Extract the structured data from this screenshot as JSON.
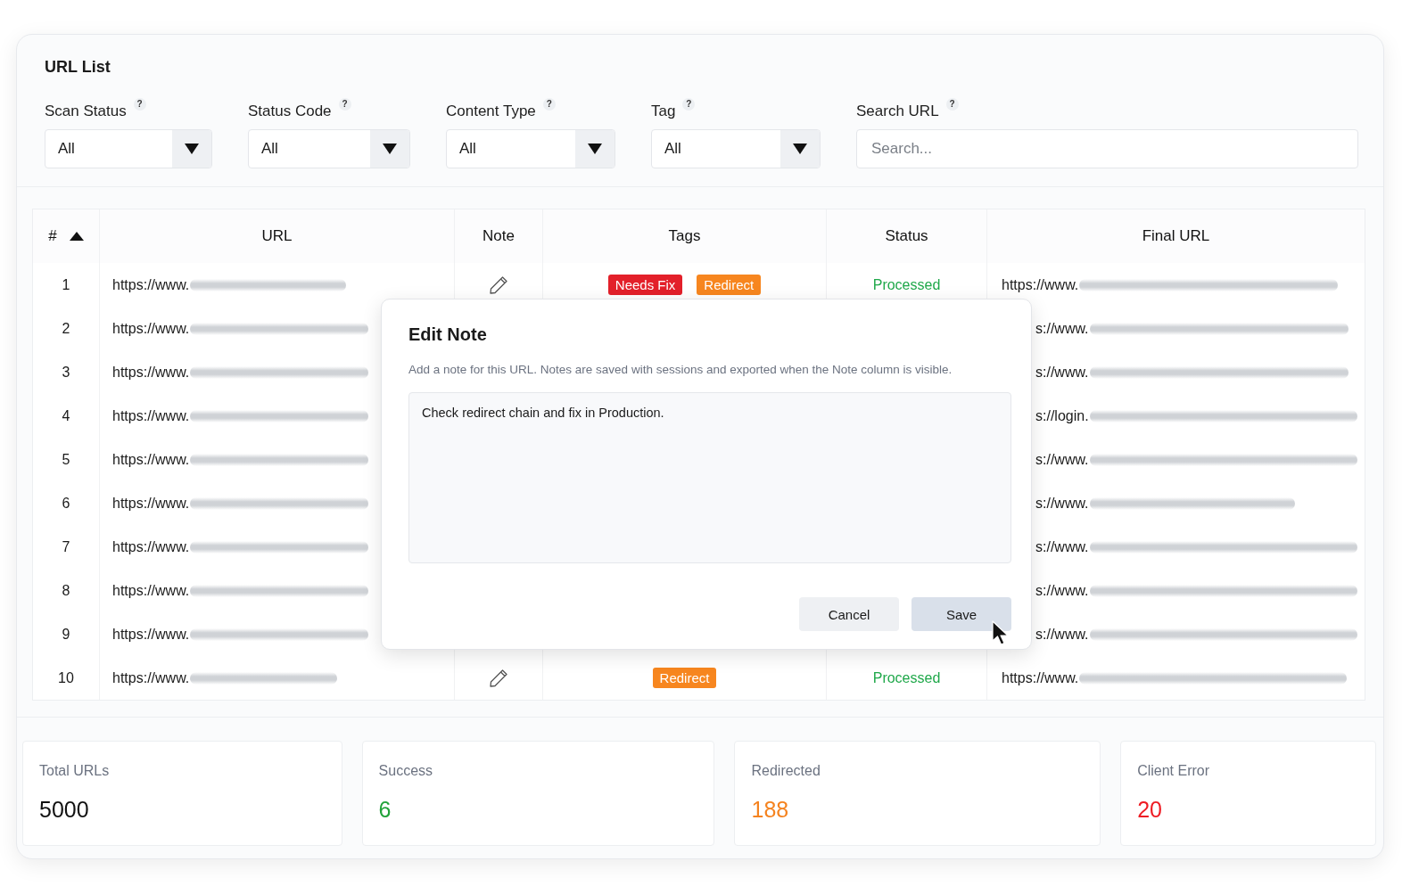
{
  "title": "URL List",
  "filters": [
    {
      "label": "Scan Status",
      "hint": "?",
      "value": "All"
    },
    {
      "label": "Status Code",
      "hint": "?",
      "value": "All"
    },
    {
      "label": "Content Type",
      "hint": "?",
      "value": "All"
    },
    {
      "label": "Tag",
      "hint": "?",
      "value": "All"
    }
  ],
  "search": {
    "label": "Search URL",
    "hint": "?",
    "placeholder": "Search..."
  },
  "table": {
    "columns": [
      {
        "label": "#",
        "sorted": true
      },
      {
        "label": "URL",
        "sorted": false
      },
      {
        "label": "Note",
        "sorted": false
      },
      {
        "label": "Tags",
        "sorted": false
      },
      {
        "label": "Status",
        "sorted": false
      },
      {
        "label": "Final URL",
        "sorted": false
      }
    ],
    "rows": [
      {
        "number": "1",
        "url": "https://www.",
        "tags": [
          {
            "label": "Needs Fix",
            "color": "#e3202a"
          },
          {
            "label": "Redirect",
            "color": "#f7861f"
          }
        ],
        "status": "Processed",
        "final_url": "https://www."
      },
      {
        "number": "2",
        "url": "https://www.",
        "final_url": "s://www."
      },
      {
        "number": "3",
        "url": "https://www.",
        "final_url": "s://www."
      },
      {
        "number": "4",
        "url": "https://www.",
        "final_url": "s://login."
      },
      {
        "number": "5",
        "url": "https://www.",
        "final_url": "s://www."
      },
      {
        "number": "6",
        "url": "https://www.",
        "final_url": "s://www."
      },
      {
        "number": "7",
        "url": "https://www.",
        "final_url": "s://www."
      },
      {
        "number": "8",
        "url": "https://www.",
        "final_url": "s://www."
      },
      {
        "number": "9",
        "url": "https://www.",
        "final_url": "s://www."
      },
      {
        "number": "10",
        "url": "https://www.",
        "tags": [
          {
            "label": "Redirect",
            "color": "#f7861f"
          }
        ],
        "status": "Processed",
        "final_url": "https://www."
      }
    ]
  },
  "dialog": {
    "title": "Edit Note",
    "description": "Add a note for this URL. Notes are saved with sessions and exported when the Note column is visible.",
    "value": "Check redirect chain and fix in Production.",
    "buttons": [
      {
        "label": "Cancel",
        "hovered": false
      },
      {
        "label": "Save",
        "hovered": true
      }
    ]
  },
  "stats": [
    {
      "label": "Total URLs",
      "value": "5000",
      "color": "#111111"
    },
    {
      "label": "Success",
      "value": "6",
      "color": "#22a23a"
    },
    {
      "label": "Redirected",
      "value": "188",
      "color": "#f5831f"
    },
    {
      "label": "Client Error",
      "value": "20",
      "color": "#ee1c24"
    }
  ]
}
